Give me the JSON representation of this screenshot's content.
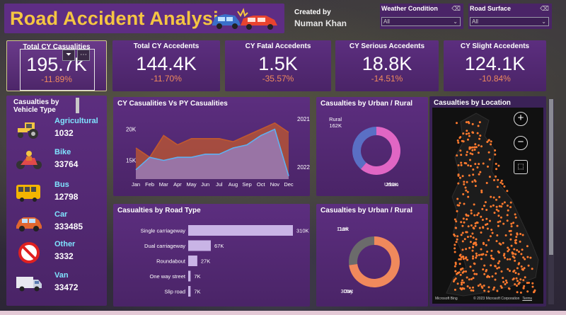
{
  "header": {
    "title": "Road Accident Analysis",
    "created_label": "Created by",
    "creator": "Numan Khan"
  },
  "filters": [
    {
      "label": "Weather Condition",
      "value": "All"
    },
    {
      "label": "Road Surface",
      "value": "All"
    }
  ],
  "kpis": [
    {
      "label": "Total CY Casualities",
      "value": "195.7K",
      "change": "-11.89%"
    },
    {
      "label": "Total CY Accedents",
      "value": "144.4K",
      "change": "-11.70%"
    },
    {
      "label": "CY Fatal Accedents",
      "value": "1.5K",
      "change": "-35.57%"
    },
    {
      "label": "CY Serious Accedents",
      "value": "18.8K",
      "change": "-14.51%"
    },
    {
      "label": "CY Slight Accedents",
      "value": "124.1K",
      "change": "-10.84%"
    }
  ],
  "vehicles": {
    "title": "Casualties by Vehicle Type",
    "items": [
      {
        "name": "Agricultural",
        "value": "1032",
        "icon": "tractor-icon"
      },
      {
        "name": "Bike",
        "value": "33764",
        "icon": "motorbike-icon"
      },
      {
        "name": "Bus",
        "value": "12798",
        "icon": "bus-icon"
      },
      {
        "name": "Car",
        "value": "333485",
        "icon": "car-icon"
      },
      {
        "name": "Other",
        "value": "3332",
        "icon": "no-entry-icon"
      },
      {
        "name": "Van",
        "value": "33472",
        "icon": "van-icon"
      }
    ]
  },
  "colors": {
    "accent_title": "#f4c542",
    "cy_line": "#c0582f",
    "py_line": "#5fb0f0",
    "urban": "#e066c4",
    "rural": "#5a6fc4",
    "day": "#f0895c",
    "dark": "#6b6b6b",
    "bar": "#c9b4e6",
    "change": "#f08a5d"
  },
  "map": {
    "title": "Casualties by Location",
    "brand": "Microsoft Bing",
    "copyright": "© 2023 Microsoft Corporation",
    "terms": "Terms"
  },
  "chart_data": [
    {
      "type": "area",
      "title": "CY Casualities Vs PY Casualities",
      "categories": [
        "Jan",
        "Feb",
        "Mar",
        "Apr",
        "May",
        "Jun",
        "Jul",
        "Aug",
        "Sep",
        "Oct",
        "Nov",
        "Dec"
      ],
      "series": [
        {
          "name": "2021",
          "values": [
            17000,
            15500,
            19000,
            17500,
            18500,
            18500,
            18500,
            18000,
            19000,
            20000,
            21000,
            19500
          ]
        },
        {
          "name": "2022",
          "values": [
            13500,
            15500,
            15000,
            15500,
            15500,
            16000,
            16000,
            17000,
            17500,
            19000,
            20000,
            12500
          ]
        }
      ],
      "yticks": [
        "15K",
        "20K"
      ],
      "ylim": [
        12000,
        22000
      ]
    },
    {
      "type": "bar",
      "title": "Casualties by Road Type",
      "categories": [
        "Single carriageway",
        "Dual carriageway",
        "Roundabout",
        "One way street",
        "Slip road"
      ],
      "values": [
        310000,
        67000,
        27000,
        7000,
        7000
      ],
      "labels": [
        "310K",
        "67K",
        "27K",
        "7K",
        "7K"
      ]
    },
    {
      "type": "pie",
      "title": "Casualties by Urban / Rural",
      "slices": [
        {
          "name": "Rural",
          "value": 162000,
          "label": "162K"
        },
        {
          "name": "Urban",
          "value": 256000,
          "label": "256K"
        }
      ]
    },
    {
      "type": "pie",
      "title": "Casualties by Urban / Rural",
      "slices": [
        {
          "name": "Dark",
          "value": 113000,
          "label": "113K"
        },
        {
          "name": "Day",
          "value": 305000,
          "label": "305K"
        }
      ]
    }
  ]
}
